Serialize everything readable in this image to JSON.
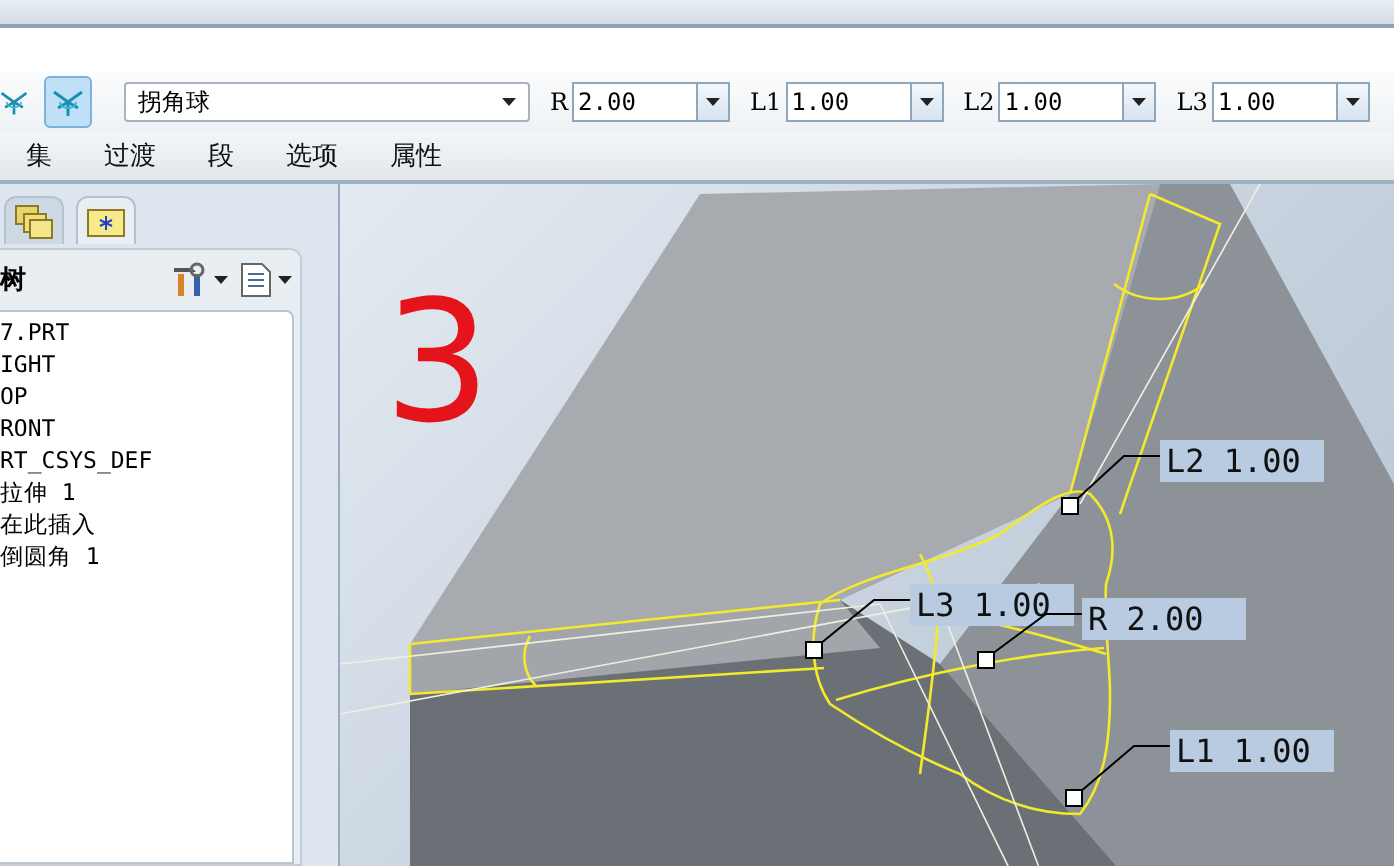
{
  "toolbar": {
    "mode_buttons": [
      {
        "selected": false
      },
      {
        "selected": true
      }
    ],
    "shape_dropdown": {
      "value": "拐角球"
    },
    "parameters": [
      {
        "label": "R",
        "value": "2.00"
      },
      {
        "label": "L1",
        "value": "1.00"
      },
      {
        "label": "L2",
        "value": "1.00"
      },
      {
        "label": "L3",
        "value": "1.00"
      }
    ]
  },
  "tabs": [
    {
      "label": "集"
    },
    {
      "label": "过渡"
    },
    {
      "label": "段"
    },
    {
      "label": "选项"
    },
    {
      "label": "属性"
    }
  ],
  "sidebar": {
    "tabs": [
      {
        "selected": false
      },
      {
        "selected": true
      }
    ],
    "header": "树",
    "tree_items": [
      {
        "label": "7.PRT"
      },
      {
        "label": "IGHT"
      },
      {
        "label": "OP"
      },
      {
        "label": "RONT"
      },
      {
        "label": "RT_CSYS_DEF"
      },
      {
        "label": "拉伸 1"
      },
      {
        "label": "在此插入"
      },
      {
        "label": "倒圆角 1"
      }
    ]
  },
  "viewport": {
    "annotation": "3",
    "dimension_labels": [
      {
        "label": "L2 1.00"
      },
      {
        "label": "L3 1.00"
      },
      {
        "label": "R 2.00"
      },
      {
        "label": "L1 1.00"
      }
    ]
  }
}
